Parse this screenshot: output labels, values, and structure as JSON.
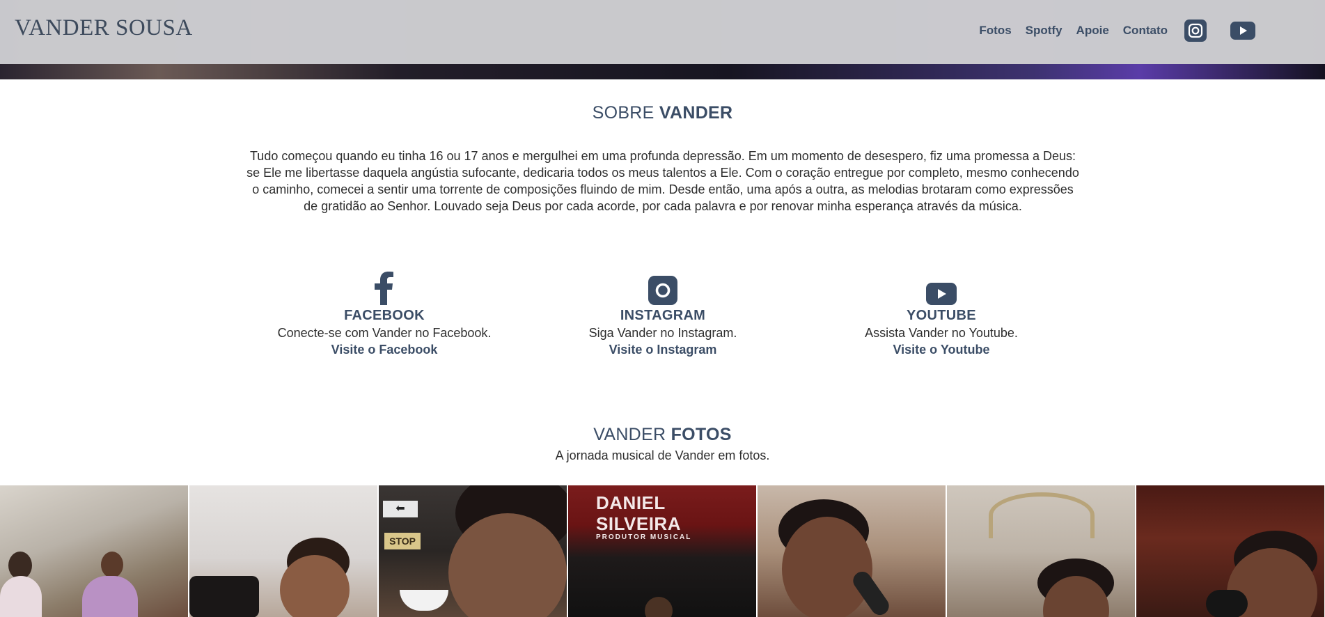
{
  "brand": "VANDER SOUSA",
  "nav": {
    "links": [
      "Fotos",
      "Spotfy",
      "Apoie",
      "Contato"
    ],
    "icons": [
      "instagram-icon",
      "youtube-icon"
    ]
  },
  "about": {
    "title_light": "SOBRE ",
    "title_bold": "VANDER",
    "text": "Tudo começou quando eu tinha 16 ou 17 anos e mergulhei em uma profunda depressão. Em um momento de desespero, fiz uma promessa a Deus: se Ele me libertasse daquela angústia sufocante, dedicaria todos os meus talentos a Ele. Com o coração entregue por completo, mesmo conhecendo o caminho, comecei a sentir uma torrente de composições fluindo de mim. Desde então, uma após a outra, as melodias brotaram como expressões de gratidão ao Senhor. Louvado seja Deus por cada acorde, por cada palavra e por renovar minha esperança através da música."
  },
  "social": [
    {
      "name": "FACEBOOK",
      "desc": "Conecte-se com Vander no Facebook.",
      "link": "Visite o Facebook",
      "icon": "facebook-icon"
    },
    {
      "name": "INSTAGRAM",
      "desc": "Siga Vander no Instagram.",
      "link": "Visite o Instagram",
      "icon": "instagram-icon"
    },
    {
      "name": "YOUTUBE",
      "desc": "Assista Vander no Youtube.",
      "link": "Visite o Youtube",
      "icon": "youtube-icon"
    }
  ],
  "photos": {
    "title_light": "VANDER ",
    "title_bold": "FOTOS",
    "subtitle": "A jornada musical de Vander em fotos.",
    "sign_text": "DANIEL SILVEIRA",
    "sign_sub": "PRODUTOR MUSICAL",
    "stop_text": "STOP",
    "arrow_text": "⬅"
  },
  "colors": {
    "accent": "#3b4d66",
    "navbar_bg": "#cecfd2"
  }
}
